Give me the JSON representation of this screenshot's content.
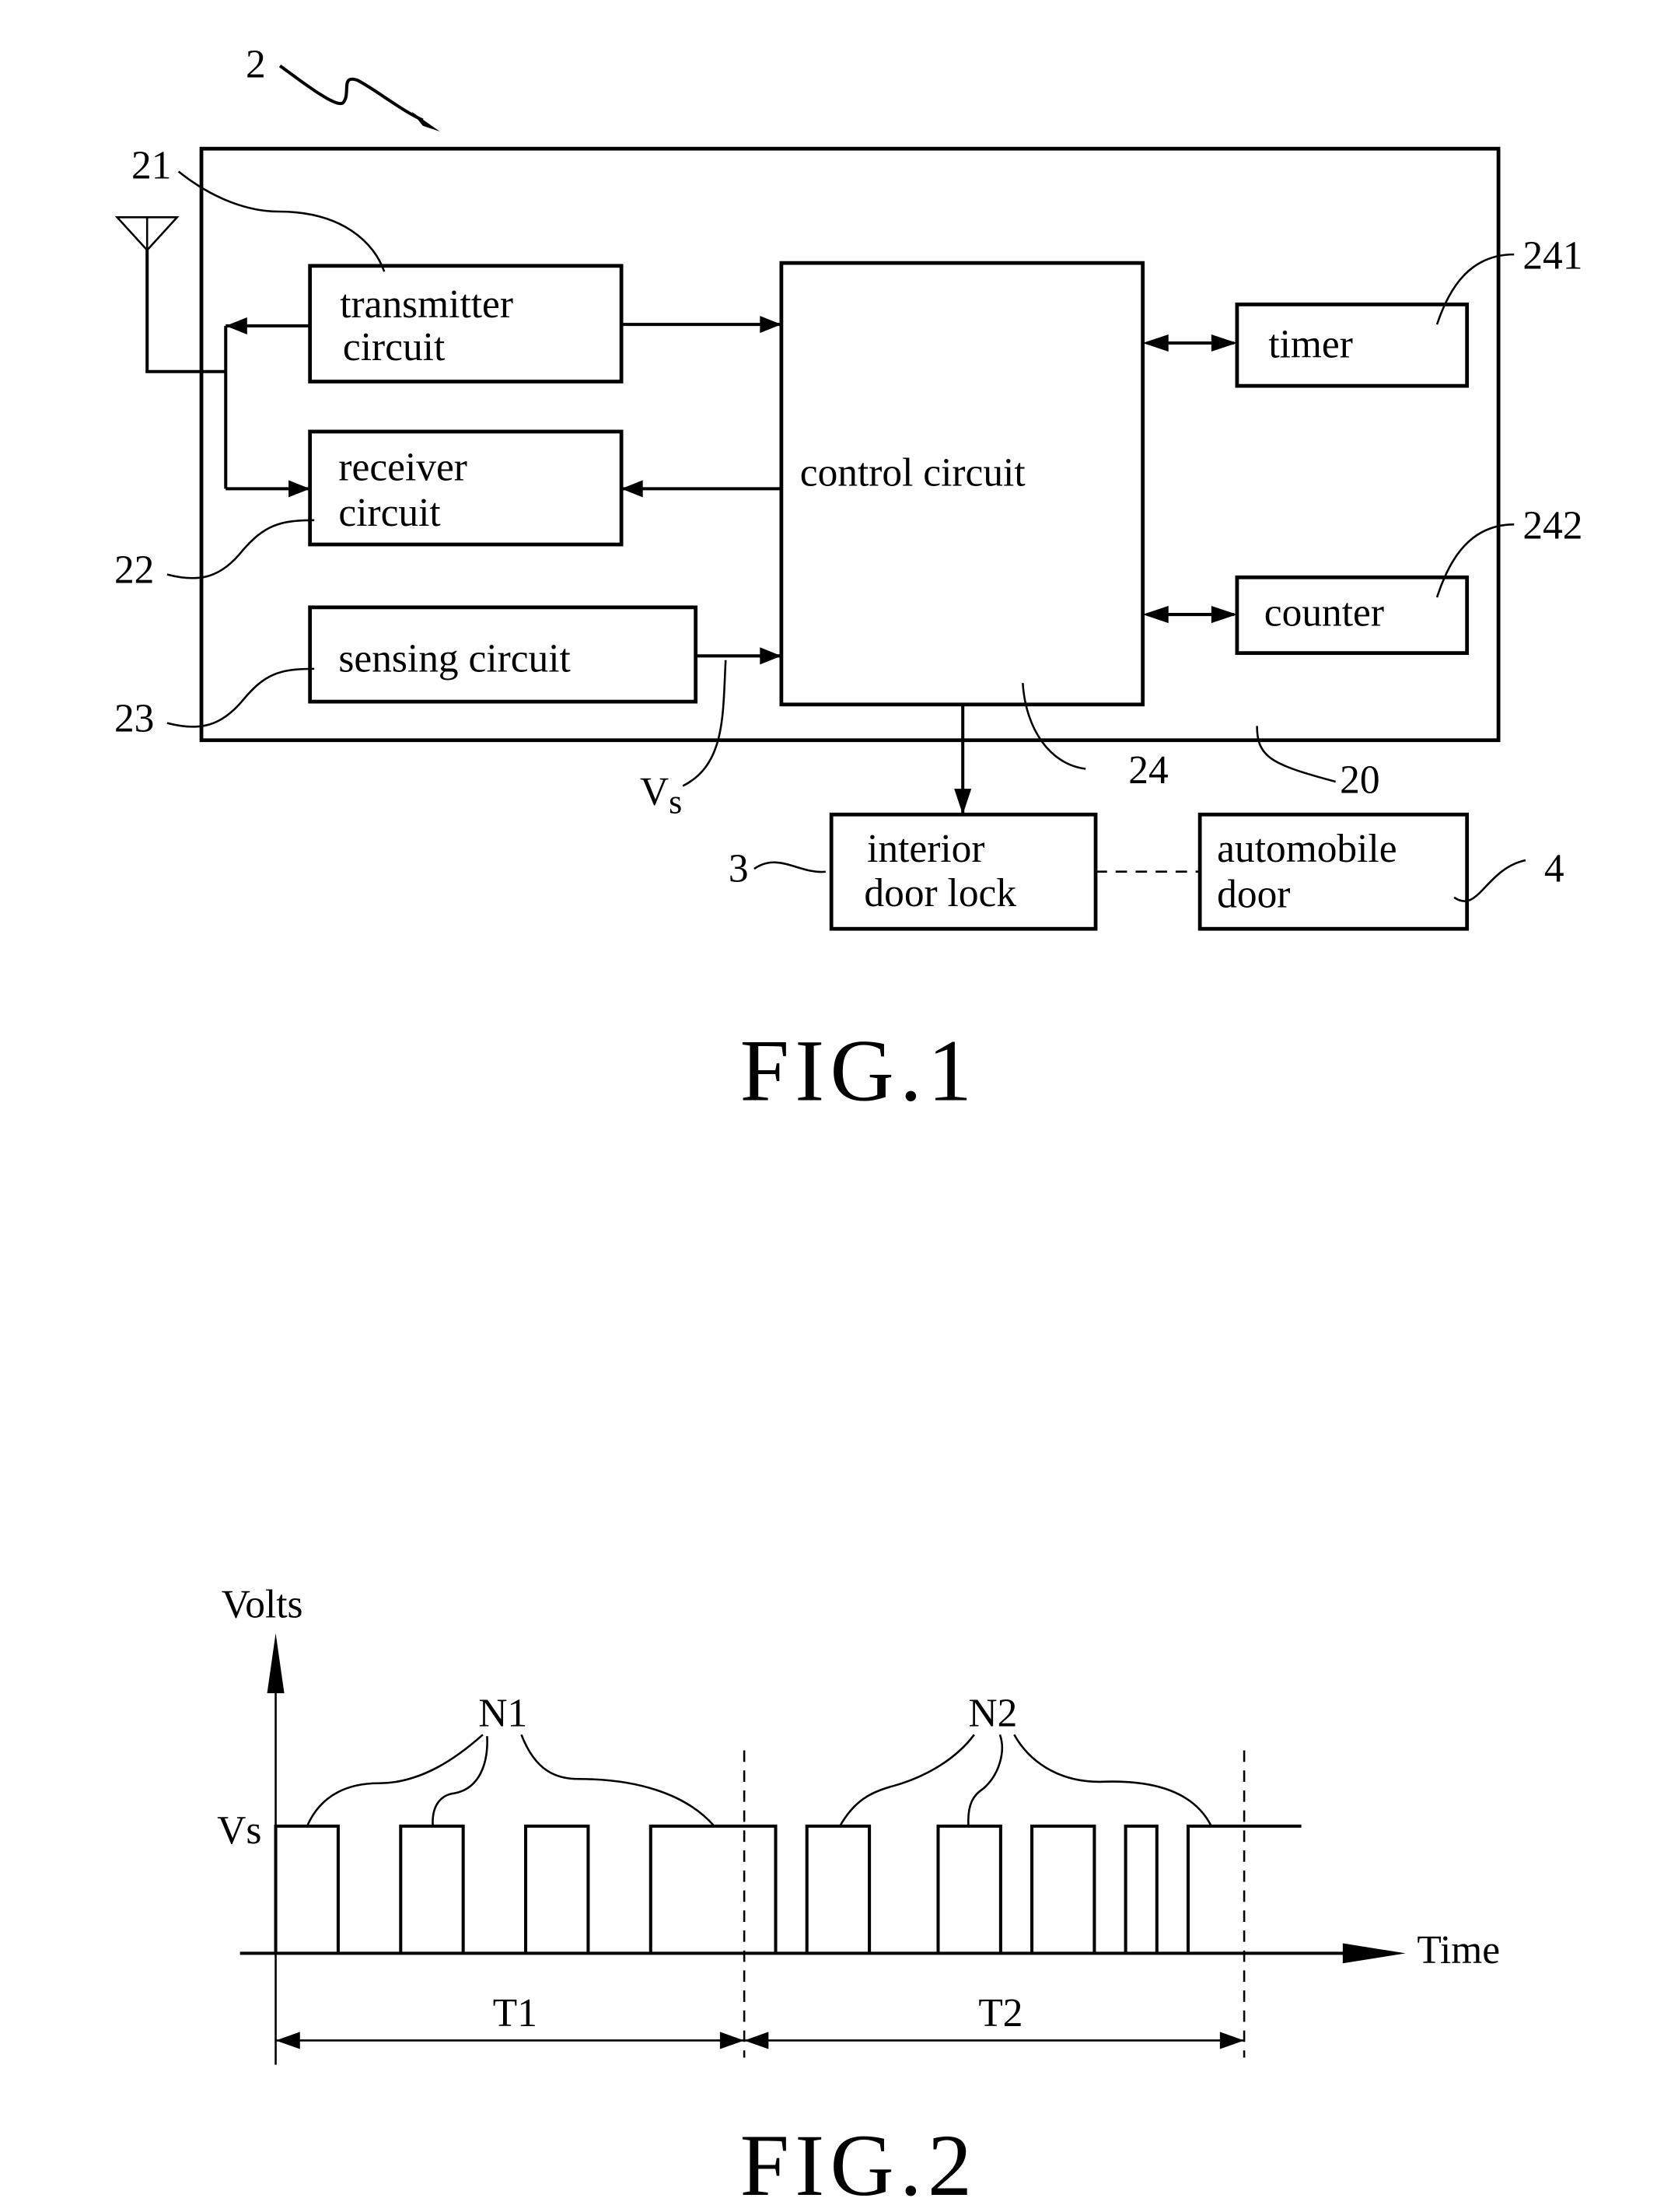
{
  "fig1": {
    "ref_system": "2",
    "ref_housing": "20",
    "blocks": {
      "transmitter": {
        "ref": "21",
        "line1": "transmitter",
        "line2": "circuit"
      },
      "receiver": {
        "ref": "22",
        "line1": "receiver",
        "line2": "circuit"
      },
      "sensing": {
        "ref": "23",
        "line1": "sensing circuit"
      },
      "control": {
        "ref": "24",
        "line1": "control circuit"
      },
      "timer": {
        "ref": "241",
        "line1": "timer"
      },
      "counter": {
        "ref": "242",
        "line1": "counter"
      },
      "door_lock": {
        "ref": "3",
        "line1": "interior",
        "line2": "door lock"
      },
      "auto_door": {
        "ref": "4",
        "line1": "automobile",
        "line2": "door"
      }
    },
    "signal_label": "V",
    "signal_subscript": "s",
    "caption": "FIG.1"
  },
  "fig2": {
    "caption": "FIG.2",
    "chart_data": {
      "type": "line",
      "title": "",
      "xlabel": "Time",
      "ylabel": "Volts",
      "ytick_labels": [
        "Vs"
      ],
      "levels": {
        "low": 0,
        "high": "Vs"
      },
      "periods": [
        {
          "name": "T1",
          "pulse_group": "N1",
          "pulse_count": 4
        },
        {
          "name": "T2",
          "pulse_group": "N2",
          "pulse_count": 5
        }
      ],
      "pulse_intervals": [
        [
          0.0,
          0.5
        ],
        [
          1.0,
          1.5
        ],
        [
          2.0,
          2.5
        ],
        [
          3.0,
          4.0
        ],
        [
          4.25,
          4.75
        ],
        [
          5.3,
          5.8
        ],
        [
          6.05,
          6.55
        ],
        [
          6.8,
          7.05
        ],
        [
          7.3,
          8.0
        ]
      ],
      "period_boundaries": [
        0,
        3.75,
        7.75
      ],
      "annotations": [
        "N1",
        "N2",
        "T1",
        "T2"
      ]
    }
  }
}
